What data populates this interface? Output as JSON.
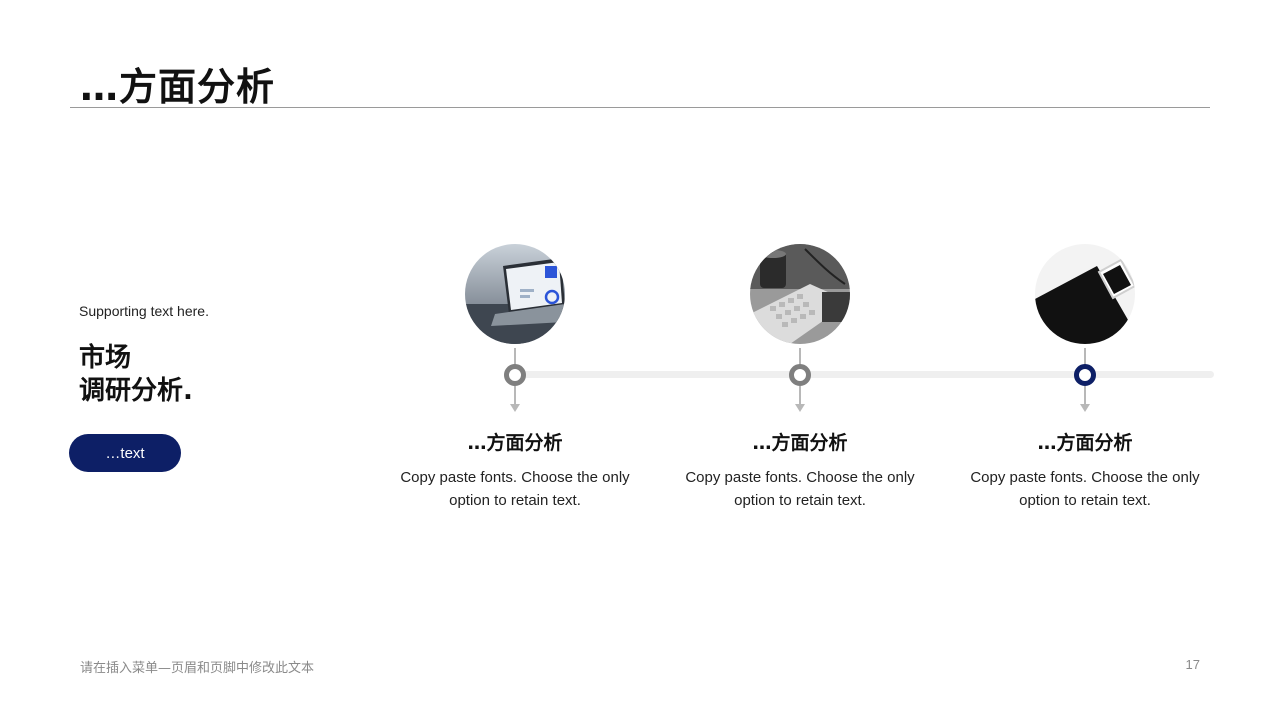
{
  "slide": {
    "title": "…方面分析",
    "supporting_text": "Supporting text here.",
    "heading_line1": "市场",
    "heading_line2": "调研分析.",
    "pill_label": "…text"
  },
  "timeline": [
    {
      "title": "…方面分析",
      "description": "Copy paste fonts. Choose the only option to retain text.",
      "photo": "laptop-dashboard-photo",
      "active": false
    },
    {
      "title": "…方面分析",
      "description": "Copy paste fonts. Choose the only option to retain text.",
      "photo": "keyboard-desk-photo",
      "active": false
    },
    {
      "title": "…方面分析",
      "description": "Copy paste fonts. Choose the only option to retain text.",
      "photo": "tablet-phone-photo",
      "active": true
    }
  ],
  "footer": {
    "text": "请在插入菜单—页眉和页脚中修改此文本",
    "page_number": "17"
  },
  "colors": {
    "accent": "#0d1f66",
    "node_inactive": "#7f7f7f",
    "track": "#efefef"
  }
}
